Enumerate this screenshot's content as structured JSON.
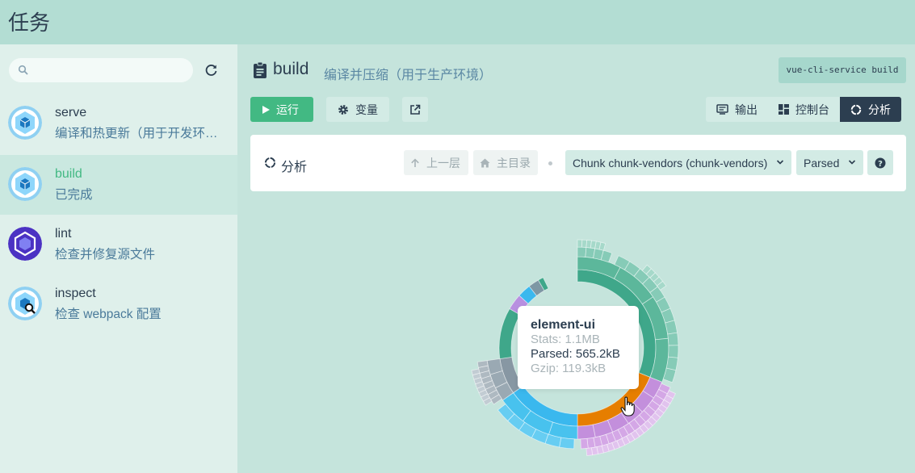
{
  "app": {
    "title": "任务"
  },
  "sidebar": {
    "search": {
      "placeholder": ""
    },
    "tasks": [
      {
        "name": "serve",
        "desc": "编译和热更新（用于开发环境）",
        "icon": "webpack-icon",
        "active": false
      },
      {
        "name": "build",
        "desc": "已完成",
        "icon": "webpack-icon",
        "active": true
      },
      {
        "name": "lint",
        "desc": "检查并修复源文件",
        "icon": "eslint-icon",
        "active": false
      },
      {
        "name": "inspect",
        "desc": "检查 webpack 配置",
        "icon": "webpack-inspect-icon",
        "active": false
      }
    ]
  },
  "main": {
    "title": "build",
    "subtitle": "编译并压缩（用于生产环境）",
    "command": "vue-cli-service build",
    "run_label": "运行",
    "vars_label": "变量",
    "views": [
      {
        "label": "输出",
        "icon": "terminal-icon",
        "active": false
      },
      {
        "label": "控制台",
        "icon": "dashboard-icon",
        "active": false
      },
      {
        "label": "分析",
        "icon": "spinner-icon",
        "active": true
      }
    ],
    "panel": {
      "title": "分析",
      "up_label": "上一层",
      "home_label": "主目录",
      "chunk_select": "Chunk chunk-vendors (chunk-vendors)",
      "size_select": "Parsed"
    },
    "tooltip": {
      "name": "element-ui",
      "stats": "Stats: 1.1MB",
      "parsed": "Parsed: 565.2kB",
      "gzip": "Gzip: 119.3kB"
    }
  },
  "colors": {
    "accent": "#42b983",
    "dark": "#2c3e50",
    "teal": "#3fa78a",
    "orange": "#e67e00",
    "purple": "#c38fdc",
    "blue": "#3ab8ee",
    "slate": "#7d97a4"
  }
}
